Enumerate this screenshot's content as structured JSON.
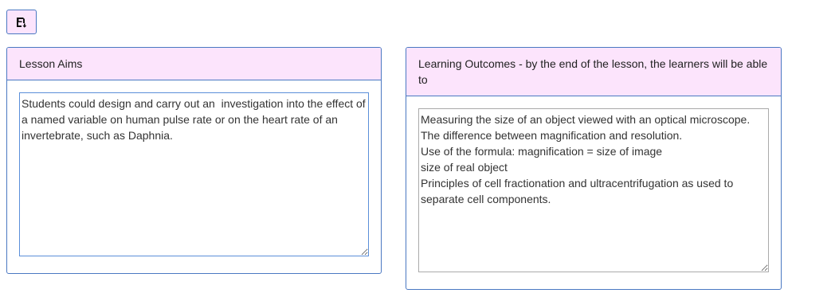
{
  "toolbar": {
    "save_icon": "save-icon"
  },
  "lesson_aims": {
    "title": "Lesson Aims",
    "value": "Students could design and carry out an  investigation into the effect of a named variable on human pulse rate or on the heart rate of an invertebrate, such as Daphnia."
  },
  "learning_outcomes": {
    "title": "Learning Outcomes - by the end of the lesson, the learners will be able to",
    "value": "Measuring the size of an object viewed with an optical microscope.\nThe difference between magnification and resolution.\nUse of the formula: magnification = size of image\nsize of real object\nPrinciples of cell fractionation and ultracentrifugation as used to separate cell components."
  },
  "colors": {
    "header_bg": "#fce4fc",
    "border": "#4a78c2"
  }
}
